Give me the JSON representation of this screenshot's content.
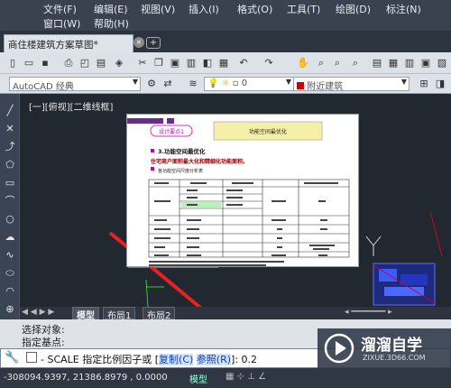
{
  "menu": {
    "row1": [
      "文件(F)",
      "编辑(E)",
      "视图(V)",
      "插入(I)",
      "格式(O)",
      "工具(T)",
      "绘图(D)",
      "标注(N)"
    ],
    "row2": [
      "窗口(W)",
      "帮助(H)"
    ]
  },
  "tab": {
    "title": "商住楼建筑方案草图*",
    "close": "×",
    "new": "+"
  },
  "toolbar": {
    "workspace": "AutoCAD 经典",
    "layer_value": "0",
    "layer_right": "附近建筑"
  },
  "view_label": "[一][俯视][二维线框]",
  "drawing": {
    "tag": "设计要点1",
    "heading": "功能空间最优化",
    "title": "3.功能空间最优化",
    "subtitle": "住宅商户面积最大化和精细化功能面积。",
    "table_caption": "各功能空间尺度分析表"
  },
  "model_tabs": [
    "模型",
    "布局1",
    "布局2"
  ],
  "command": {
    "history1": "选择对象:",
    "history2": "指定基点:",
    "prompt": "- SCALE 指定比例因子或 [",
    "opt1": "复制(C)",
    "opt2": "参照(R)",
    "suffix": "]:",
    "value": "0.2"
  },
  "status": {
    "coords": "-308094.9397, 21386.8979 , 0.0000",
    "model": "模型"
  },
  "watermark": {
    "brand": "溜溜自学",
    "url": "ZIXUE.3D66.COM"
  }
}
